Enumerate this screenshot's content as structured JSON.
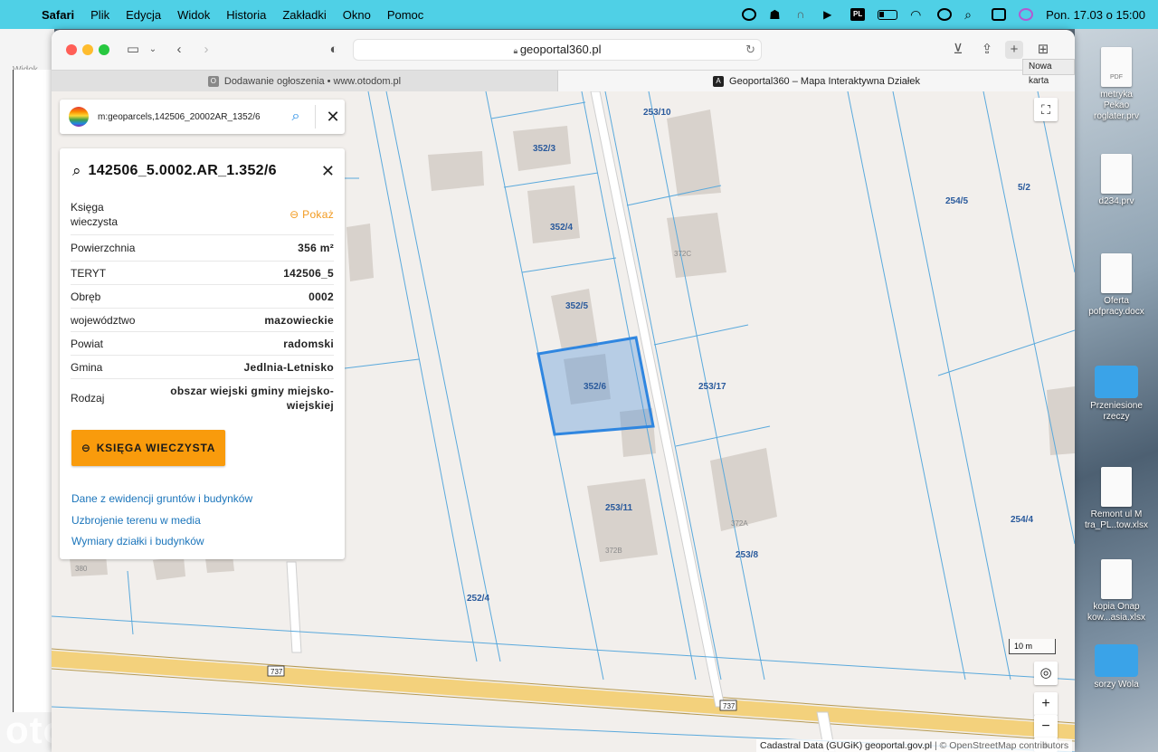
{
  "menubar": {
    "app": "Safari",
    "items": [
      "Plik",
      "Edycja",
      "Widok",
      "Historia",
      "Zakładki",
      "Okno",
      "Pomoc"
    ],
    "lang": "PL",
    "clock": "Pon. 17.03 o  15:00"
  },
  "background_window": {
    "widok": "Widok",
    "watermark": "otodom"
  },
  "browser": {
    "url": "geoportal360.pl",
    "tooltip": "Nowa karta",
    "tabs": [
      {
        "label": "Dodawanie ogłoszenia • www.otodom.pl",
        "favicon": "O"
      },
      {
        "label": "Geoportal360 – Mapa Interaktywna Działek",
        "favicon": "A"
      }
    ]
  },
  "search": {
    "query": "m:geoparcels,142506_20002AR_1352/6"
  },
  "panel": {
    "title": "142506_5.0002.AR_1.352/6",
    "rows": [
      {
        "label": "Księga\nwieczysta",
        "value": "Pokaż",
        "link": true
      },
      {
        "label": "Powierzchnia",
        "value": "356 m²"
      },
      {
        "label": "TERYT",
        "value": "142506_5"
      },
      {
        "label": "Obręb",
        "value": "0002"
      },
      {
        "label": "województwo",
        "value": "mazowieckie"
      },
      {
        "label": "Powiat",
        "value": "radomski"
      },
      {
        "label": "Gmina",
        "value": "Jedlnia-Letnisko"
      },
      {
        "label": "Rodzaj",
        "value": "obszar wiejski gminy miejsko-\nwiejskiej"
      }
    ],
    "button": "KSIĘGA WIECZYSTA",
    "links": [
      "Dane z ewidencji gruntów i budynków",
      "Uzbrojenie terenu w media",
      "Wymiary działki i budynków"
    ]
  },
  "map": {
    "parcel_labels": [
      "253/10",
      "352/3",
      "352/4",
      "352/5",
      "352/6",
      "253/17",
      "253/11",
      "253/8",
      "252/4",
      "254/5",
      "5/2",
      "254/4"
    ],
    "building_labels": [
      "372C",
      "372A",
      "372B",
      "380"
    ],
    "road_labels": [
      "737",
      "737"
    ],
    "scale": "10 m",
    "attribution_main": "Cadastral Data (GUGiK) geoportal.gov.pl",
    "attribution_rest": " | © OpenStreetMap contributors",
    "selected_color": "#4a90d9"
  },
  "desktop": {
    "items": [
      "metryka\nPekao\nroglater.prv",
      "d234.prv",
      "Oferta\npofpracy.docx",
      "Przeniesione\nrzeczy",
      "Remont ul M\ntra_PL..tow.xlsx",
      "kopia Onap\nkow...asia.xlsx",
      "sorzy Wola"
    ]
  }
}
